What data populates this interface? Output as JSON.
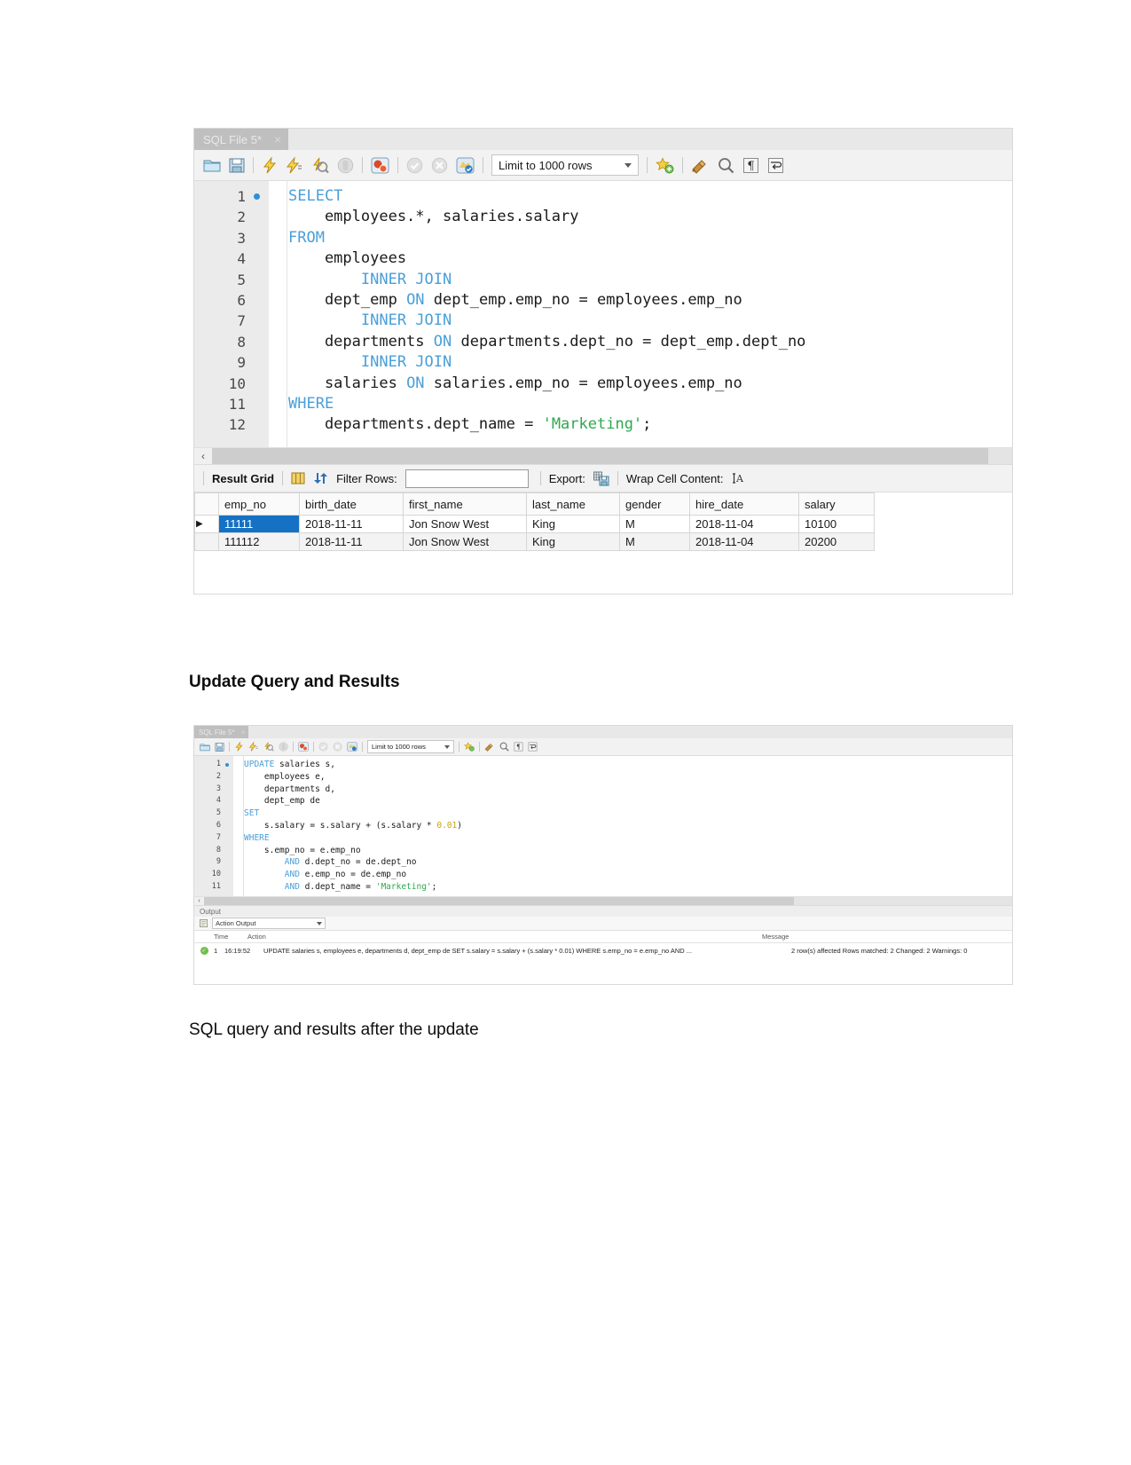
{
  "document": {
    "heading": "Update Query and Results",
    "caption": "SQL query and results after the update"
  },
  "select_window": {
    "tab": {
      "label": "SQL File 5*",
      "close": "×"
    },
    "toolbar": {
      "icons": [
        "open-file-icon",
        "save-file-icon",
        "execute-icon",
        "execute-current-statement-icon",
        "explain-query-icon",
        "stop-icon",
        "toggle-breakpoint-icon",
        "commit-icon",
        "rollback-icon",
        "autocommit-icon",
        "beautify-icon",
        "find-icon",
        "invisible-chars-icon",
        "wrapping-icon"
      ],
      "limit_label": "Limit to 1000 rows"
    },
    "editor": {
      "line_numbers": [
        "1",
        "2",
        "3",
        "4",
        "5",
        "6",
        "7",
        "8",
        "9",
        "10",
        "11",
        "12"
      ],
      "lines": [
        [
          {
            "t": "SELECT",
            "c": "kw"
          }
        ],
        [
          {
            "t": "    employees.*, salaries.salary",
            "c": ""
          }
        ],
        [
          {
            "t": "FROM",
            "c": "kw"
          }
        ],
        [
          {
            "t": "    employees",
            "c": ""
          }
        ],
        [
          {
            "t": "        ",
            "c": ""
          },
          {
            "t": "INNER JOIN",
            "c": "kw"
          }
        ],
        [
          {
            "t": "    dept_emp ",
            "c": ""
          },
          {
            "t": "ON",
            "c": "kw"
          },
          {
            "t": " dept_emp.emp_no = employees.emp_no",
            "c": ""
          }
        ],
        [
          {
            "t": "        ",
            "c": ""
          },
          {
            "t": "INNER JOIN",
            "c": "kw"
          }
        ],
        [
          {
            "t": "    departments ",
            "c": ""
          },
          {
            "t": "ON",
            "c": "kw"
          },
          {
            "t": " departments.dept_no = dept_emp.dept_no",
            "c": ""
          }
        ],
        [
          {
            "t": "        ",
            "c": ""
          },
          {
            "t": "INNER JOIN",
            "c": "kw"
          }
        ],
        [
          {
            "t": "    salaries ",
            "c": ""
          },
          {
            "t": "ON",
            "c": "kw"
          },
          {
            "t": " salaries.emp_no = employees.emp_no",
            "c": ""
          }
        ],
        [
          {
            "t": "WHERE",
            "c": "kw"
          }
        ],
        [
          {
            "t": "    departments.dept_name = ",
            "c": ""
          },
          {
            "t": "'Marketing'",
            "c": "str"
          },
          {
            "t": ";",
            "c": ""
          }
        ]
      ]
    },
    "result_bar": {
      "result_grid_label": "Result Grid",
      "filter_label": "Filter Rows:",
      "filter_value": "",
      "filter_placeholder": "",
      "export_label": "Export:",
      "wrap_label": "Wrap Cell Content:",
      "wrap_icon_glyph": "IA"
    },
    "result_table": {
      "columns": [
        "emp_no",
        "birth_date",
        "first_name",
        "last_name",
        "gender",
        "hire_date",
        "salary"
      ],
      "rows": [
        {
          "marker": "▶",
          "selected_col": 0,
          "cells": [
            "11111",
            "2018-11-11",
            "Jon Snow West",
            "King",
            "M",
            "2018-11-04",
            "10100"
          ]
        },
        {
          "marker": "",
          "selected_col": -1,
          "cells": [
            "111112",
            "2018-11-11",
            "Jon Snow West",
            "King",
            "M",
            "2018-11-04",
            "20200"
          ]
        }
      ]
    }
  },
  "update_window": {
    "tab": {
      "label": "SQL File 5*",
      "close": "×"
    },
    "toolbar": {
      "limit_label": "Limit to 1000 rows"
    },
    "editor": {
      "line_numbers": [
        "1",
        "2",
        "3",
        "4",
        "5",
        "6",
        "7",
        "8",
        "9",
        "10",
        "11"
      ],
      "lines": [
        [
          {
            "t": "UPDATE",
            "c": "kw"
          },
          {
            "t": " salaries s,",
            "c": ""
          }
        ],
        [
          {
            "t": "    employees e,",
            "c": ""
          }
        ],
        [
          {
            "t": "    departments d,",
            "c": ""
          }
        ],
        [
          {
            "t": "    dept_emp de",
            "c": ""
          }
        ],
        [
          {
            "t": "SET",
            "c": "kw"
          }
        ],
        [
          {
            "t": "    s.salary = s.salary + (s.salary * ",
            "c": ""
          },
          {
            "t": "0.01",
            "c": "num"
          },
          {
            "t": ")",
            "c": ""
          }
        ],
        [
          {
            "t": "WHERE",
            "c": "kw"
          }
        ],
        [
          {
            "t": "    s.emp_no = e.emp_no",
            "c": ""
          }
        ],
        [
          {
            "t": "        ",
            "c": ""
          },
          {
            "t": "AND",
            "c": "kw"
          },
          {
            "t": " d.dept_no = de.dept_no",
            "c": ""
          }
        ],
        [
          {
            "t": "        ",
            "c": ""
          },
          {
            "t": "AND",
            "c": "kw"
          },
          {
            "t": " e.emp_no = de.emp_no",
            "c": ""
          }
        ],
        [
          {
            "t": "        ",
            "c": ""
          },
          {
            "t": "AND",
            "c": "kw"
          },
          {
            "t": " d.dept_name = ",
            "c": ""
          },
          {
            "t": "'Marketing'",
            "c": "str"
          },
          {
            "t": ";",
            "c": ""
          }
        ]
      ]
    },
    "output": {
      "panel_title": "Output",
      "selector_value": "Action Output",
      "columns": [
        "",
        "Time",
        "Action",
        "Message"
      ],
      "rows": [
        {
          "status": "success",
          "index": "1",
          "time": "16:19:52",
          "action": "UPDATE salaries s,   employees e,   departments d,   dept_emp de  SET   s.salary = s.salary + (s.salary * 0.01) WHERE   s.emp_no = e.emp_no      AND ...",
          "message": "2 row(s) affected Rows matched: 2  Changed: 2  Warnings: 0"
        }
      ]
    }
  },
  "colors": {
    "keyword": "#4a9fd8",
    "string": "#2fa84f",
    "number": "#c8a415",
    "selection": "#1471c4",
    "tab_bg": "#bfbfbf"
  }
}
